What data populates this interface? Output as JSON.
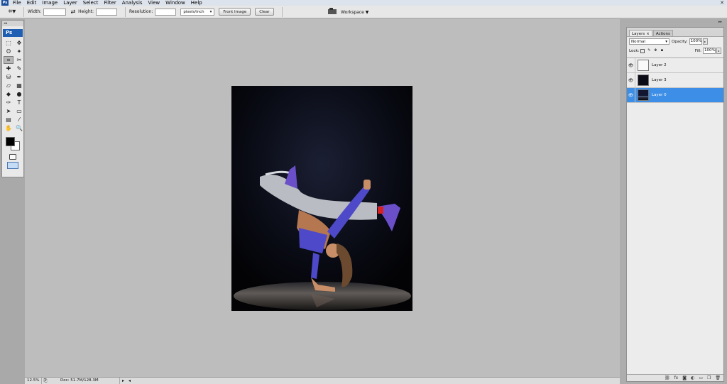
{
  "menubar": {
    "logo": "Ps",
    "items": [
      "File",
      "Edit",
      "Image",
      "Layer",
      "Select",
      "Filter",
      "Analysis",
      "View",
      "Window",
      "Help"
    ],
    "close": "✕"
  },
  "options": {
    "width_label": "Width:",
    "height_label": "Height:",
    "resolution_label": "Resolution:",
    "units": "pixels/inch",
    "front_image": "Front Image",
    "clear": "Clear",
    "workspace": "Workspace"
  },
  "toolbox": {
    "logo": "Ps",
    "tools": [
      "marquee",
      "move",
      "lasso",
      "magic-wand",
      "crop",
      "slice",
      "healing",
      "brush",
      "clone-stamp",
      "history-brush",
      "eraser",
      "gradient",
      "blur",
      "dodge",
      "pen",
      "type",
      "path-select",
      "shape",
      "notes",
      "eyedropper",
      "hand",
      "zoom"
    ],
    "tool_glyphs": [
      "⬚",
      "✥",
      "ʘ",
      "✦",
      "⌗",
      "✂",
      "✚",
      "✎",
      "⛁",
      "✒",
      "▱",
      "▦",
      "◆",
      "●",
      "✑",
      "T",
      "➤",
      "▭",
      "▤",
      "⁄",
      "✋",
      "🔍"
    ],
    "active_tool": 4,
    "foreground": "#000000",
    "background": "#ffffff"
  },
  "status": {
    "zoom": "12.5%",
    "doc": "Doc: 51.7M/128.3M"
  },
  "layers_panel": {
    "tabs": [
      "Layers",
      "Actions"
    ],
    "tab_close": "×",
    "blend_mode": "Normal",
    "opacity_label": "Opacity:",
    "opacity": "100%",
    "lock_label": "Lock:",
    "fill_label": "Fill:",
    "fill": "100%",
    "layers": [
      {
        "name": "Layer 2",
        "visible": true,
        "selected": false
      },
      {
        "name": "Layer 3",
        "visible": true,
        "selected": false
      },
      {
        "name": "Layer 0",
        "visible": true,
        "selected": true
      }
    ]
  },
  "colors": {
    "accent": "#3d8ee6",
    "ps_blue": "#1f5fb3",
    "canvas_bg": "#06070b"
  }
}
